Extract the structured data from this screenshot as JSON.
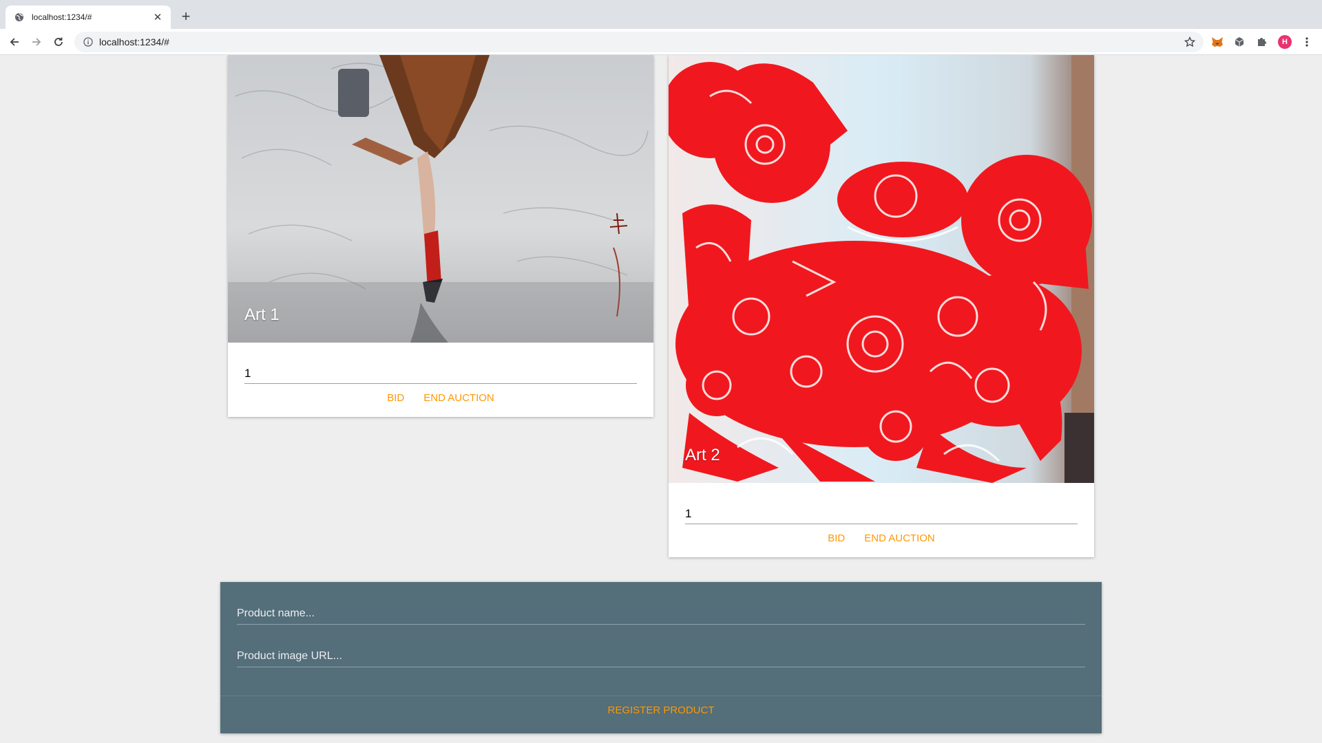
{
  "browser": {
    "tab_title": "localhost:1234/#",
    "url": "localhost:1234/#",
    "avatar_initial": "H",
    "icons": [
      "globe-icon",
      "close-icon",
      "plus-icon",
      "back-icon",
      "forward-icon",
      "reload-icon",
      "info-icon",
      "star-icon",
      "metamask-fox-icon",
      "cube-icon",
      "puzzle-icon",
      "kebab-menu-icon"
    ]
  },
  "products": [
    {
      "caption": "Art 1",
      "bid_value": "1",
      "bid_label": "BID",
      "end_label": "END AUCTION"
    },
    {
      "caption": "Art 2",
      "bid_value": "1",
      "bid_label": "BID",
      "end_label": "END AUCTION"
    }
  ],
  "register": {
    "name_placeholder": "Product name...",
    "image_placeholder": "Product image URL...",
    "button_label": "REGISTER PRODUCT"
  },
  "colors": {
    "page_bg": "#eeeeee",
    "accent": "#ff9800",
    "form_bg": "#546e7a",
    "art2_red": "#f0181e"
  }
}
